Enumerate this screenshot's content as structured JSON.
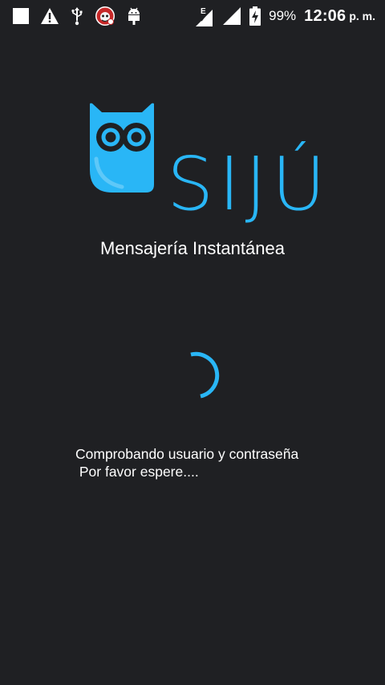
{
  "status_bar": {
    "network_type": "E",
    "battery_percent": "99%",
    "time": "12:06",
    "ampm": "p. m."
  },
  "app": {
    "brand": "SIJÚ",
    "tagline": "Mensajería Instantánea"
  },
  "loading": {
    "line1": "Comprobando usuario y contraseña",
    "line2": " Por favor espere...."
  },
  "colors": {
    "background": "#1f2023",
    "accent": "#29b6f6"
  },
  "icons": [
    "square-notification-icon",
    "warning-icon",
    "usb-icon",
    "app-notification-icon",
    "android-debug-icon",
    "signal-e-icon",
    "signal-icon",
    "battery-charging-icon",
    "owl-logo-icon"
  ]
}
